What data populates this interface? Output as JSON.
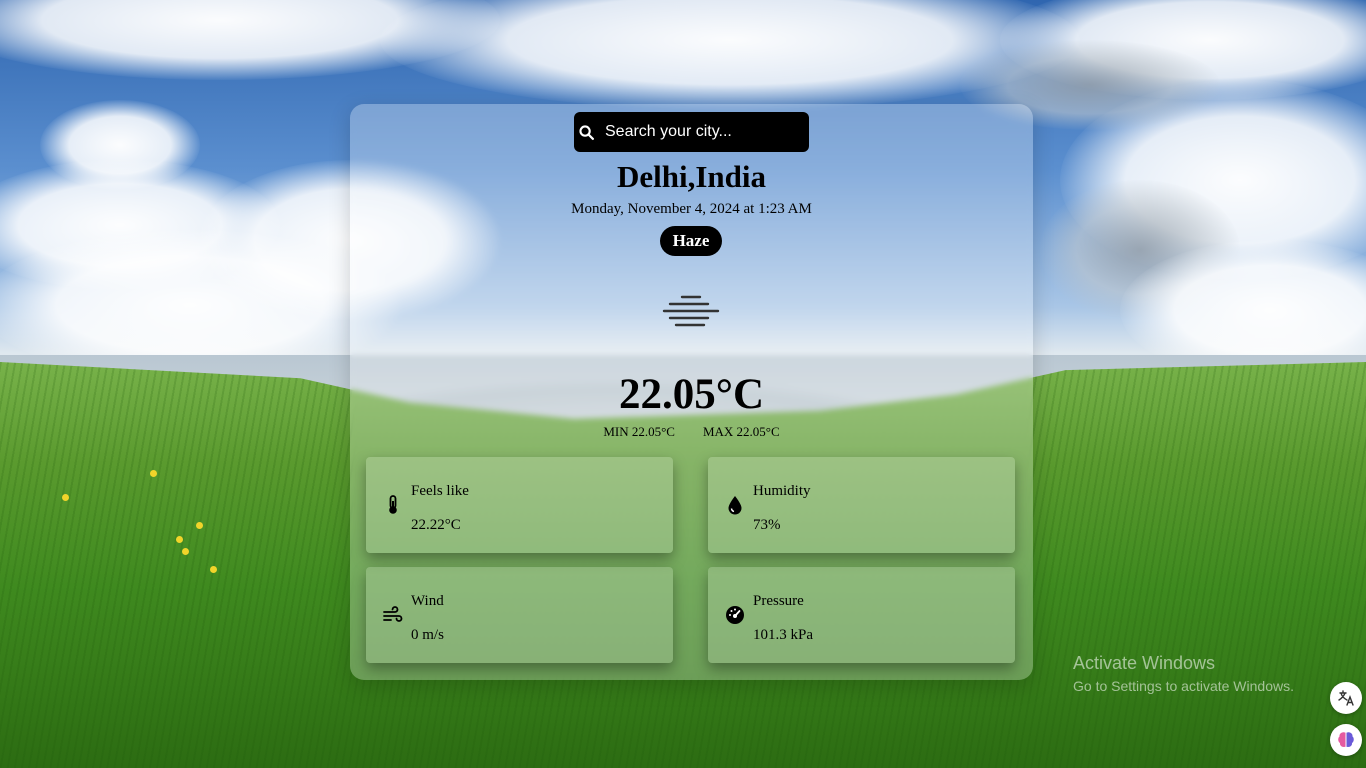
{
  "search": {
    "placeholder": "Search your city..."
  },
  "location": {
    "city": "Delhi,India",
    "datetime": "Monday, November 4, 2024 at 1:23 AM"
  },
  "condition": {
    "label": "Haze",
    "icon": "haze-icon"
  },
  "temperature": {
    "current": "22.05°C",
    "min": "MIN 22.05°C",
    "max": "MAX 22.05°C"
  },
  "details": {
    "feels_like": {
      "label": "Feels like",
      "value": "22.22°C",
      "icon": "thermometer-icon"
    },
    "humidity": {
      "label": "Humidity",
      "value": "73%",
      "icon": "water-drop-icon"
    },
    "wind": {
      "label": "Wind",
      "value": "0 m/s",
      "icon": "wind-icon"
    },
    "pressure": {
      "label": "Pressure",
      "value": "101.3 kPa",
      "icon": "gauge-icon"
    }
  },
  "watermark": {
    "title": "Activate Windows",
    "subtitle": "Go to Settings to activate Windows."
  },
  "colors": {
    "card_background": "#ffffff",
    "accent": "#000000"
  }
}
